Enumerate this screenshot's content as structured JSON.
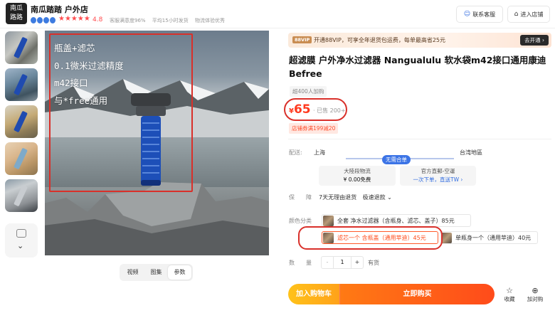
{
  "shop": {
    "logo_text": "南瓜\n路路",
    "name": "南瓜踏踏 户外店",
    "rating": "4.8",
    "stats": [
      "客服满意度96%",
      "平均15小时发货",
      "物流体验优秀"
    ],
    "contact_button": "联系客服",
    "enter_button": "进入店铺"
  },
  "gallery": {
    "overlay_lines": [
      "瓶盖+滤芯",
      "0.1微米过滤精度",
      "m42接口",
      "与*free通用"
    ],
    "media_tabs": [
      "视频",
      "图集",
      "参数"
    ],
    "active_tab": "参数"
  },
  "vip": {
    "tag": "88VIP",
    "text": "开通88VIP，可享全年退货包运费，每单最高省25元",
    "button": "去开通 ›"
  },
  "product": {
    "title": "超滤膜 户外净水过滤器 Nangualulu 软水袋m42接口通用康迪Befree",
    "sold_tag": "超400人加购",
    "price_symbol": "¥",
    "price": "65",
    "sold_count": "· 已售 200+",
    "coupon": "店铺券满199减20"
  },
  "shipping": {
    "label": "配送:",
    "from": "上海",
    "badge": "无需合单",
    "to": "台湾地區",
    "options": [
      {
        "name": "大陸段物流",
        "price": "¥ 0.00免费"
      },
      {
        "name": "官方直郵-空運",
        "price": "一次下单，直送TW ›"
      }
    ]
  },
  "guarantee": {
    "label": "保　　障",
    "items": [
      "7天无理由退货",
      "极速退款 ⌄"
    ]
  },
  "sku": {
    "label": "颜色分类",
    "options": [
      "全套 净水过滤器（含瓶身、滤芯、盖子）85元",
      "滤芯一个 含瓶盖（通用苹迪）45元",
      "单瓶身一个（通用苹迪）40元"
    ],
    "selected_index": 1
  },
  "quantity": {
    "label": "数　　量",
    "value": "1",
    "minus": "-",
    "plus": "+",
    "stock": "有货"
  },
  "actions": {
    "add_to_cart": "加入购物车",
    "buy_now": "立即购买",
    "favorite": "收藏",
    "compare": "加对购"
  },
  "colors": {
    "accent_red": "#ff3a1f",
    "highlight_box": "#d9302a",
    "cart_button": "#ffa21a",
    "buy_button": "#ff4b1a",
    "shipping_blue": "#3c74e6"
  }
}
